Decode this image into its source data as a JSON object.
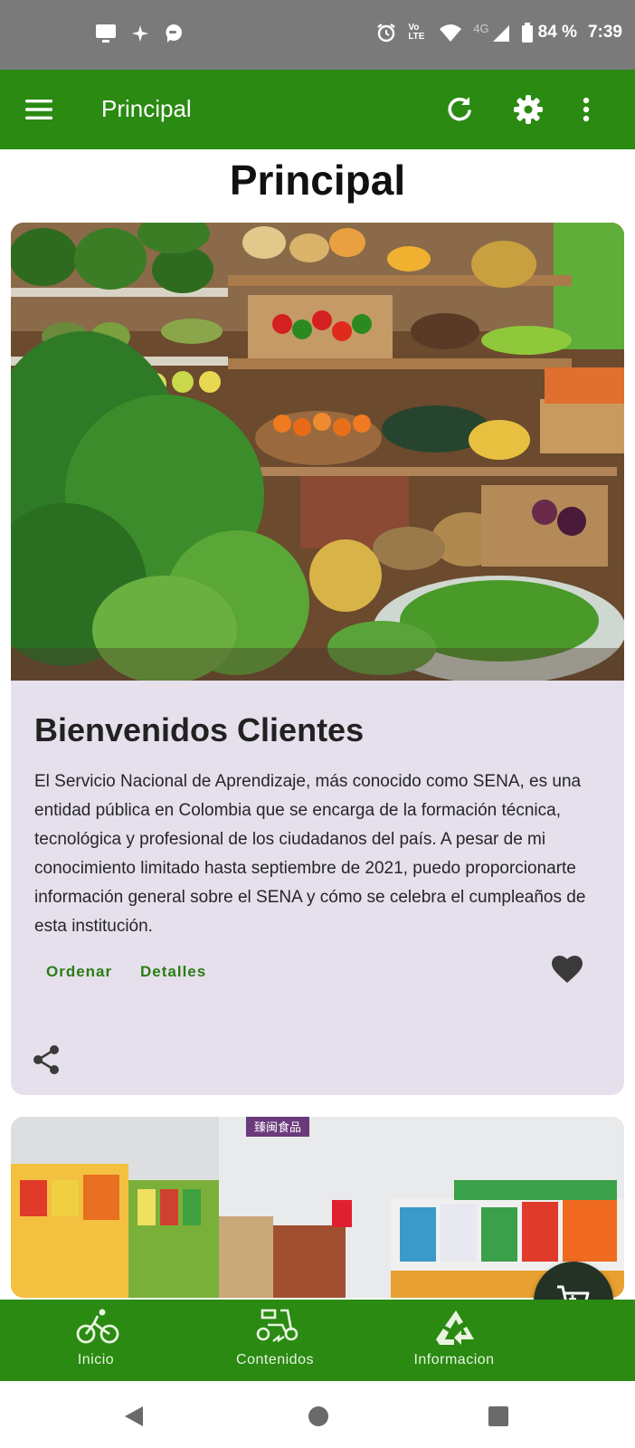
{
  "status_bar": {
    "time": "7:39",
    "battery": "84 %",
    "network": "4G",
    "volte": "Vo LTE"
  },
  "app_bar": {
    "title": "Principal",
    "icons": [
      "menu-icon",
      "refresh-icon",
      "settings-icon",
      "more-vert-icon"
    ]
  },
  "page": {
    "title": "Principal"
  },
  "cards": [
    {
      "image": "fruit-vegetable-market-photo",
      "title": "Bienvenidos Clientes",
      "body": "El Servicio Nacional de Aprendizaje, más conocido como SENA, es una entidad pública en Colombia que se encarga de la formación técnica, tecnológica y profesional de los ciudadanos del país. A pesar de mi conocimiento limitado hasta septiembre de 2021, puedo proporcionarte información general sobre el SENA y cómo se celebra el cumpleaños de esta institución.",
      "actions": [
        "Ordenar",
        "Detalles"
      ],
      "icons": [
        "heart-icon",
        "share-icon"
      ]
    },
    {
      "image": "supermarket-aisle-photo",
      "sign_text": "臻闽食品"
    }
  ],
  "fab": {
    "icon": "cart-icon"
  },
  "bottom_nav": [
    {
      "label": "Inicio",
      "icon": "bicycle-icon"
    },
    {
      "label": "Contenidos",
      "icon": "scooter-icon"
    },
    {
      "label": "Informacion",
      "icon": "recycle-icon"
    }
  ],
  "system_nav": [
    "back-icon",
    "home-icon",
    "recents-icon"
  ],
  "colors": {
    "primary": "#2a8a12",
    "card_background": "#e5e0ec",
    "action_text": "#2a7d14",
    "fab": "#233225"
  }
}
